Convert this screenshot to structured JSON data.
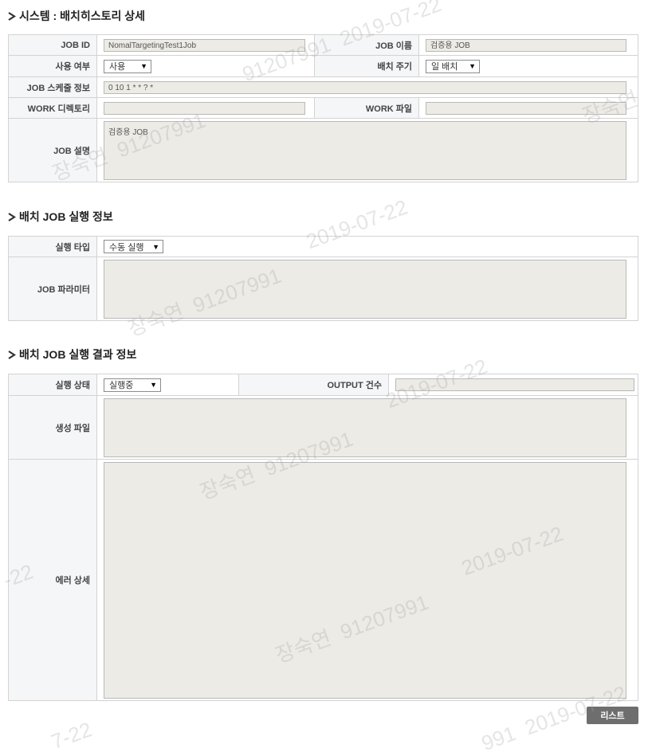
{
  "page": {
    "title": "시스템 : 배치히스토리 상세",
    "list_button": "리스트"
  },
  "batch_info": {
    "job_id_label": "JOB ID",
    "job_id_value": "NomalTargetingTest1Job",
    "job_name_label": "JOB 이름",
    "job_name_value": "검증용 JOB",
    "use_label": "사용 여부",
    "use_value": "사용",
    "cycle_label": "배치 주기",
    "cycle_value": "일 배치",
    "schedule_label": "JOB 스케줄 정보",
    "schedule_value": "0 10 1 * * ? *",
    "work_dir_label": "WORK 디렉토리",
    "work_dir_value": "",
    "work_file_label": "WORK 파일",
    "work_file_value": "",
    "desc_label": "JOB 설명",
    "desc_value": "검증용 JOB"
  },
  "exec_info": {
    "title": "배치 JOB 실행 정보",
    "type_label": "실행 타입",
    "type_value": "수동 실행",
    "param_label": "JOB 파라미터",
    "param_value": ""
  },
  "result_info": {
    "title": "배치 JOB 실행 결과 정보",
    "status_label": "실행 상태",
    "status_value": "실행중",
    "output_label": "OUTPUT 건수",
    "output_value": "",
    "file_label": "생성 파일",
    "file_value": "",
    "error_label": "에러 상세",
    "error_value": ""
  },
  "watermark": {
    "name": "장숙연",
    "id": "91207991",
    "date": "2019-07-22",
    "date_partial_1": "-22",
    "date_partial_2": "7-22",
    "date_partial_3": "991",
    "date_partial_4": "2019-07-22"
  },
  "colors": {
    "label_bg": "#f5f6f8",
    "readonly_bg": "#ecebe5",
    "border": "#d3d3d3",
    "button_bg": "#6e6e6e"
  }
}
